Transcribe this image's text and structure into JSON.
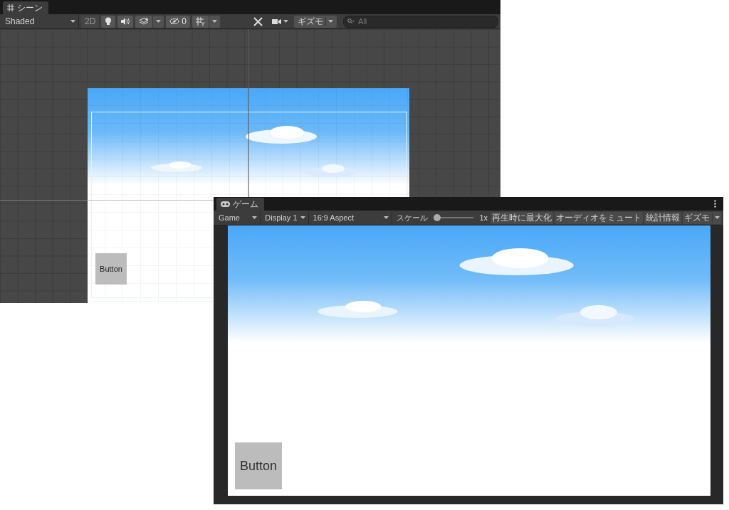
{
  "scene_window": {
    "tab": "シーン",
    "shading_mode": "Shaded",
    "view_toggles": [
      {
        "kind": "mode",
        "label": "2D",
        "on": false
      },
      {
        "kind": "lighting",
        "on": true
      },
      {
        "kind": "audio",
        "on": true
      },
      {
        "kind": "effects",
        "on": true
      },
      {
        "kind": "visibility",
        "label": "0",
        "on": true
      },
      {
        "kind": "grid",
        "on": true
      }
    ],
    "gizmos": "ギズモ",
    "search": {
      "placeholder": "All"
    },
    "ui_button": "Button"
  },
  "game_window": {
    "tab": "ゲーム",
    "view": "Game",
    "display": "Display 1",
    "aspect": "16:9 Aspect",
    "scale_label": "スケール",
    "scale": {
      "level": 0
    },
    "scale_reading": "1x",
    "toggles": [
      "再生時に最大化",
      "オーディオをミュート",
      "統計情報"
    ],
    "gizmos": "ギズモ",
    "ui_button": "Button"
  }
}
